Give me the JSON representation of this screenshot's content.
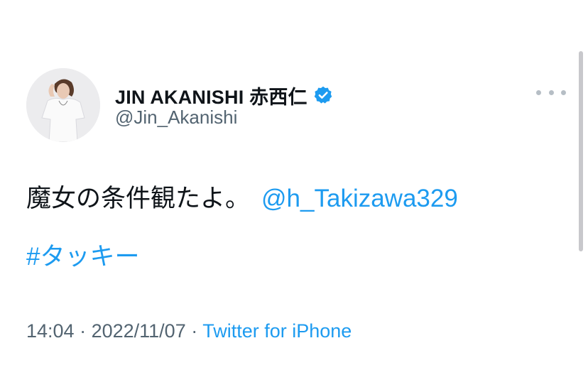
{
  "user": {
    "display_name": "JIN AKANISHI 赤西仁",
    "handle": "@Jin_Akanishi",
    "verified_color": "#1d9bf0"
  },
  "tweet": {
    "text": "魔女の条件観たよ。",
    "mention": "@h_Takizawa329",
    "hashtag": "#タッキー"
  },
  "meta": {
    "time": "14:04",
    "separator1": " · ",
    "date": "2022/11/07",
    "separator2": " · ",
    "source": "Twitter for iPhone"
  },
  "icons": {
    "verified": "verified-badge-icon",
    "more": "more-options-icon"
  },
  "colors": {
    "link": "#1d9bf0",
    "text": "#0f1419",
    "secondary": "#536471"
  }
}
